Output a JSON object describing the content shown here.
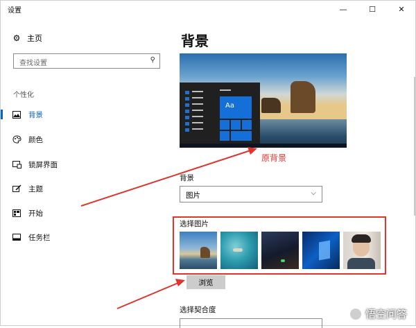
{
  "window": {
    "title": "设置"
  },
  "titlebar": {
    "minimize": "—",
    "maximize": "☐",
    "close": "✕"
  },
  "sidebar": {
    "home": {
      "label": "主页",
      "icon": "gear-icon"
    },
    "search": {
      "placeholder": "查找设置",
      "icon": "search-icon"
    },
    "section": "个性化",
    "items": [
      {
        "label": "背景",
        "icon": "picture-icon",
        "active": true
      },
      {
        "label": "颜色",
        "icon": "palette-icon"
      },
      {
        "label": "锁屏界面",
        "icon": "lock-screen-icon"
      },
      {
        "label": "主题",
        "icon": "brush-icon"
      },
      {
        "label": "开始",
        "icon": "start-icon"
      },
      {
        "label": "任务栏",
        "icon": "taskbar-icon"
      }
    ]
  },
  "main": {
    "heading": "背景",
    "preview": {
      "tile_text": "Aa"
    },
    "annotation": "原背景",
    "background_label": "背景",
    "background_value": "图片",
    "choose_label": "选择图片",
    "browse_label": "浏览",
    "fit_label": "选择契合度"
  },
  "watermark": "悟空问答",
  "colors": {
    "accent": "#0a63c9",
    "annotation": "#e0342c",
    "tile": "#1470d8"
  }
}
